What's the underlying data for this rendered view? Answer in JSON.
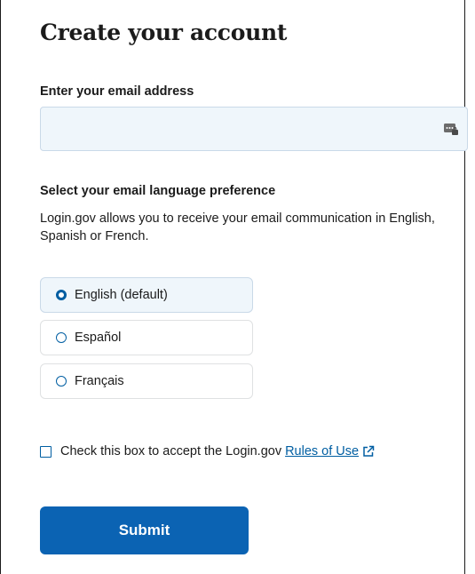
{
  "form": {
    "title": "Create your account",
    "email": {
      "label": "Enter your email address",
      "value": "",
      "placeholder": ""
    },
    "language": {
      "label": "Select your email language preference",
      "description": "Login.gov allows you to receive your email communication in English, Spanish or French.",
      "options": [
        {
          "label": "English (default)",
          "selected": true
        },
        {
          "label": "Español",
          "selected": false
        },
        {
          "label": "Français",
          "selected": false
        }
      ]
    },
    "terms": {
      "text": "Check this box to accept the Login.gov",
      "link_text": "Rules of Use",
      "checked": false
    },
    "submit_label": "Submit"
  },
  "colors": {
    "primary": "#005ea2",
    "button": "#0b63b3",
    "field_bg": "#eff6fb",
    "text": "#1b1b1b"
  },
  "icons": {
    "email_autofill": "password-manager-icon",
    "external_link": "external-link-icon"
  }
}
